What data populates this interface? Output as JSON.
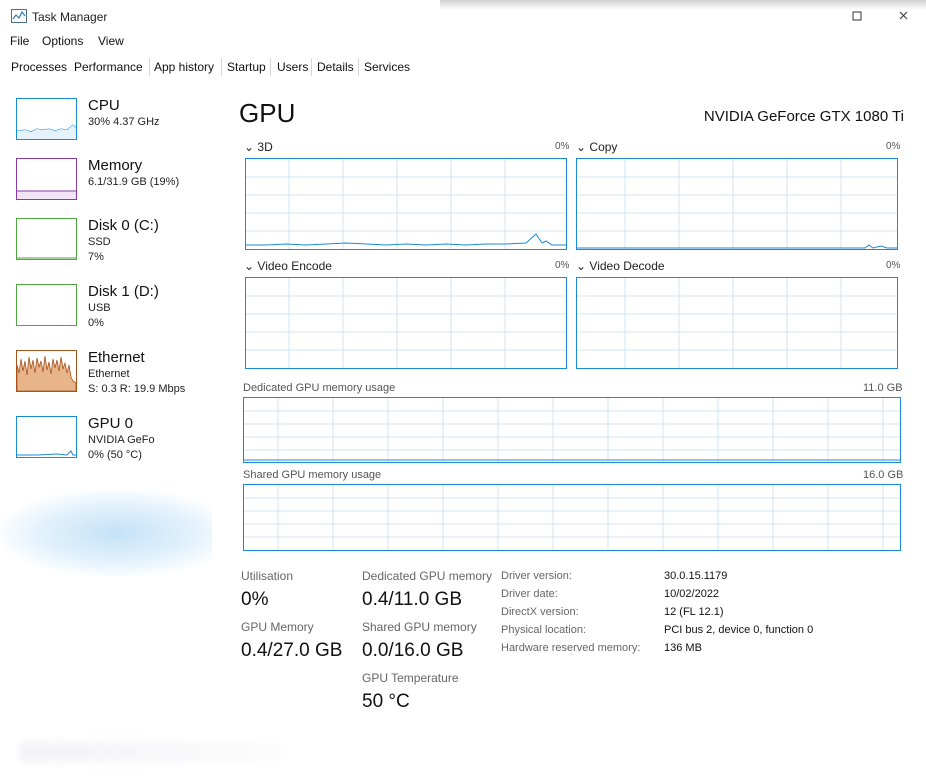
{
  "window": {
    "title": "Task Manager",
    "icon": "task-manager-icon"
  },
  "menu": [
    "File",
    "Options",
    "View"
  ],
  "tabs": [
    "Processes",
    "Performance",
    "App history",
    "Startup",
    "Users",
    "Details",
    "Services"
  ],
  "sidebar": {
    "items": [
      {
        "name": "CPU",
        "line1": "30%  4.37 GHz",
        "line2": "",
        "color": "#1b8ad6"
      },
      {
        "name": "Memory",
        "line1": "6.1/31.9 GB (19%)",
        "line2": "",
        "color": "#8b3aa8"
      },
      {
        "name": "Disk 0 (C:)",
        "line1": "SSD",
        "line2": "7%",
        "color": "#4da63f"
      },
      {
        "name": "Disk 1 (D:)",
        "line1": "USB",
        "line2": "0%",
        "color": "#4da63f"
      },
      {
        "name": "Ethernet",
        "line1": "Ethernet",
        "line2": "S: 0.3  R: 19.9 Mbps",
        "color": "#a7531a"
      },
      {
        "name": "GPU 0",
        "line1": "NVIDIA GeFo",
        "line2": "0% (50 °C)",
        "color": "#1b8ad6"
      }
    ]
  },
  "gpu": {
    "title": "GPU",
    "model": "NVIDIA GeForce GTX 1080 Ti",
    "graphs": [
      {
        "label": "3D",
        "pct": "0%"
      },
      {
        "label": "Copy",
        "pct": "0%"
      },
      {
        "label": "Video Encode",
        "pct": "0%"
      },
      {
        "label": "Video Decode",
        "pct": "0%"
      }
    ],
    "dedicated_mem_label": "Dedicated GPU memory usage",
    "dedicated_mem_max": "11.0 GB",
    "shared_mem_label": "Shared GPU memory usage",
    "shared_mem_max": "16.0 GB",
    "stats": {
      "utilisation_label": "Utilisation",
      "utilisation_value": "0%",
      "gpu_memory_label": "GPU Memory",
      "gpu_memory_value": "0.4/27.0 GB",
      "dedicated_label": "Dedicated GPU memory",
      "dedicated_value": "0.4/11.0 GB",
      "shared_label": "Shared GPU memory",
      "shared_value": "0.0/16.0 GB",
      "temp_label": "GPU Temperature",
      "temp_value": "50 °C"
    },
    "info": [
      {
        "label": "Driver version:",
        "value": "30.0.15.1179"
      },
      {
        "label": "Driver date:",
        "value": "10/02/2022"
      },
      {
        "label": "DirectX version:",
        "value": "12 (FL 12.1)"
      },
      {
        "label": "Physical location:",
        "value": "PCI bus 2, device 0, function 0"
      },
      {
        "label": "Hardware reserved memory:",
        "value": "136 MB"
      }
    ]
  },
  "colors": {
    "accent": "#1b8ad6",
    "grid": "#cfe6f6"
  }
}
